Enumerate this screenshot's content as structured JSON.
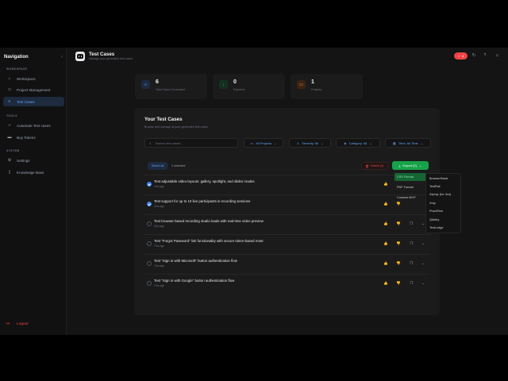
{
  "sidebar": {
    "title": "Navigation",
    "sections": [
      {
        "label": "WORKSPACE",
        "items": [
          {
            "label": "WorkSpace",
            "icon": "home-icon"
          },
          {
            "label": "Project Management",
            "icon": "folder-icon"
          },
          {
            "label": "Test Cases",
            "icon": "list-icon",
            "active": true
          }
        ]
      },
      {
        "label": "TOOLS",
        "items": [
          {
            "label": "Automate Test cases",
            "icon": "code-icon"
          },
          {
            "label": "Buy Tokens",
            "icon": "card-icon"
          }
        ]
      },
      {
        "label": "SYSTEM",
        "items": [
          {
            "label": "Settings",
            "icon": "gear-icon"
          },
          {
            "label": "Knowledge Base",
            "icon": "book-icon"
          }
        ]
      }
    ],
    "logout": "Logout"
  },
  "header": {
    "title": "Test Cases",
    "subtitle": "Manage your generated test cases",
    "badge_count": "4"
  },
  "stats": [
    {
      "value": "6",
      "label": "Total Cases Generated",
      "icon": "file-icon",
      "color": "#3b82f6"
    },
    {
      "value": "0",
      "label": "Exported",
      "icon": "download-icon",
      "color": "#22c55e"
    },
    {
      "value": "1",
      "label": "Projects",
      "icon": "folder-icon",
      "color": "#f97316"
    }
  ],
  "panel": {
    "title": "Your Test Cases",
    "subtitle": "Browse and manage all your generated test cases",
    "search_placeholder": "Search test cases...",
    "filters": [
      {
        "label": "All Projects",
        "icon": "folder-icon"
      },
      {
        "label": "Severity: All",
        "icon": "alert-icon"
      },
      {
        "label": "Category: All",
        "icon": "tag-icon"
      },
      {
        "label": "Time: All Time",
        "icon": "calendar-icon"
      }
    ],
    "select_all": "Select All",
    "selected_count": "2 selected",
    "delete_label": "Delete (2)",
    "export_label": "Export (2)"
  },
  "test_cases": [
    {
      "title": "Test adjustable video layouts: gallery, spotlight, and slides modes",
      "time": "1hrs ago",
      "checked": true
    },
    {
      "title": "Test support for up to 10 live participants in recording sessions",
      "time": "4hrs ago",
      "checked": true
    },
    {
      "title": "Test browser-based recording studio loads with real-time video preview",
      "time": "5hrs ago",
      "checked": false
    },
    {
      "title": "Test \"Forgot Password\" link functionality with secure token-based reset",
      "time": "7hrs ago",
      "checked": false
    },
    {
      "title": "Test \"Sign in with Microsoft\" button authentication flow",
      "time": "7hrs ago",
      "checked": false
    },
    {
      "title": "Test \"Sign in with Google\" button authentication flow",
      "time": "7hrs ago",
      "checked": false
    }
  ],
  "export_menu": {
    "items": [
      "CSV Format",
      "PDF Format",
      "Connect MCP"
    ],
    "submenu": [
      "BrowserStack",
      "TestRail",
      "Zephyr (for Jira)",
      "Xray",
      "PractiTest",
      "QMetry",
      "TestLodge"
    ]
  },
  "colors": {
    "accent": "#3b82f6",
    "danger": "#ef4444",
    "success": "#16a34a"
  }
}
